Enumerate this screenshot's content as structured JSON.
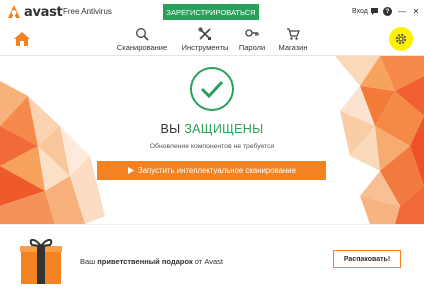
{
  "app": {
    "brand": "avast",
    "product": "Free Antivirus",
    "register_label": "ЗАРЕГИСТРИРОВАТЬСЯ",
    "login_label": "Вход",
    "help_label": "?",
    "minimize_label": "—",
    "close_label": "✕",
    "colors": {
      "accent_orange": "#f58220",
      "accent_green": "#2aa05a",
      "highlight_yellow": "#fff200"
    }
  },
  "nav": {
    "items": [
      {
        "label": "Сканирование",
        "icon": "search-icon"
      },
      {
        "label": "Инструменты",
        "icon": "tools-icon"
      },
      {
        "label": "Пароли",
        "icon": "key-icon"
      },
      {
        "label": "Магазин",
        "icon": "cart-icon"
      }
    ],
    "home_icon": "home-icon",
    "settings_icon": "gear-icon"
  },
  "status": {
    "title_prefix": "ВЫ ",
    "title_highlight": "ЗАЩИЩЕНЫ",
    "subtitle": "Обновление компонентов не требуется",
    "scan_button_label": "Запустить интеллектуальное сканирование"
  },
  "promo": {
    "text_prefix": "Ваш ",
    "text_bold": "приветственный подарок",
    "text_suffix": " от Avast",
    "button_label": "Распаковать!"
  }
}
